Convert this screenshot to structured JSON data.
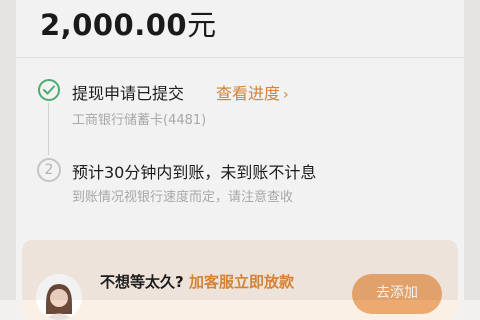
{
  "withdrawal": {
    "amount": "2,000.00",
    "currency_unit": "元"
  },
  "steps": [
    {
      "status": "completed",
      "title": "提现申请已提交",
      "link_label": "查看进度",
      "subtitle": "工商银行储蓄卡(4481)"
    },
    {
      "status": "pending",
      "number": "2",
      "title": "预计30分钟内到账，未到账不计息",
      "subtitle": "到账情况视银行速度而定，请注意查收"
    }
  ],
  "promo": {
    "text_plain": "不想等太久?",
    "text_highlight": "加客服立即放款",
    "button_label": "去添加"
  },
  "colors": {
    "accent": "#e08a3c",
    "success": "#55b47a",
    "promo_bg": "#fbf0e6",
    "button": "#ecaa70"
  }
}
